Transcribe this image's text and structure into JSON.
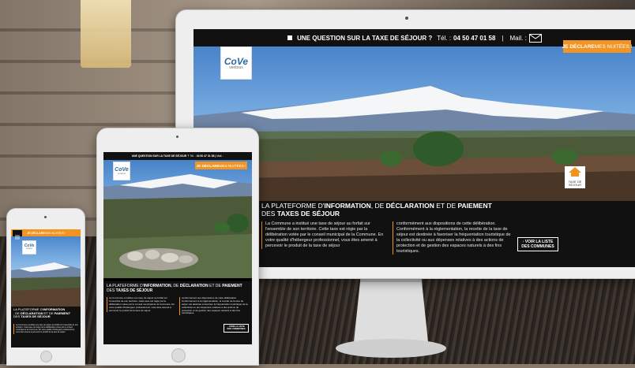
{
  "topbar": {
    "question": "UNE QUESTION SUR LA TAXE DE SÉJOUR ?",
    "tel_label": "Tél. :",
    "tel_number": "04 50 47 01 58",
    "separator": "|",
    "mail_label": "Mail. :"
  },
  "declare": {
    "strong": "JE DÉCLARE",
    "rest": " MES NUITÉES !"
  },
  "logo": {
    "text": "CoVe",
    "subtitle": "ventoux"
  },
  "badge": {
    "line1": "TAXE DE",
    "line2": "SÉJOUR"
  },
  "headline": {
    "part1": "LA PLATEFORME D'",
    "part2": "INFORMATION",
    "part3": ", DE ",
    "part4": "DÉCLARATION",
    "part5": " ET DE ",
    "part6": "PAIEMENT",
    "part7": "DES ",
    "part8": "TAXES DE SÉJOUR"
  },
  "paragraph1": "La Commune a institué une taxe de séjour au forfait sur l'ensemble de son territoire. Cette taxe est régie par la délibération votée par le conseil municipal de la Commune. En votre qualité d'hébergeur professionnel, vous êtes amené à percevoir le produit de la taxe de séjour",
  "paragraph2": "conformément aux dispositions de cette délibération. Conformément à la réglementation, la recette de la taxe de séjour est destinée à favoriser la fréquentation touristique de la collectivité ou aux dépenses relatives à des actions de protection et de gestion des espaces naturels à des fins touristiques.",
  "button": {
    "line1": "VOIR LA LISTE",
    "line2": "DES COMMUNES",
    "arrow": "›"
  },
  "colors": {
    "accent": "#f19421",
    "bar": "#111111"
  },
  "icons": [
    "menu-icon",
    "mail-icon",
    "phone-square-icon",
    "house-icon"
  ]
}
